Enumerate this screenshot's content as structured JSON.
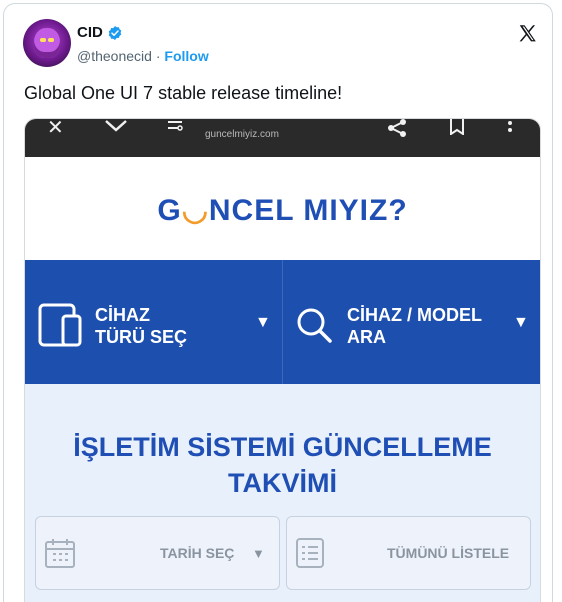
{
  "post": {
    "author": "CID",
    "handle": "@theonecid",
    "separator": "·",
    "follow_label": "Follow",
    "text": "Global One UI 7 stable release timeline!"
  },
  "screenshot": {
    "browser": {
      "url": "guncelmiyiz.com"
    },
    "site_logo": {
      "part1": "G",
      "smile": "◡",
      "part2": "NCEL MIYIZ?"
    },
    "nav": {
      "device_type": {
        "line1": "CİHAZ",
        "line2": "TÜRÜ SEÇ"
      },
      "device_search": {
        "line1": "CİHAZ / MODEL",
        "line2": "ARA"
      },
      "arrow": "▼"
    },
    "hero": {
      "title_line1": "İŞLETİM SİSTEMİ GÜNCELLEME",
      "title_line2": "TAKVİMİ",
      "date_select": "TARİH SEÇ",
      "date_arrow": "▼",
      "list_all": "TÜMÜNÜ LİSTELE"
    }
  },
  "colors": {
    "brand_blue": "#1d4fae",
    "accent_orange": "#f19c2b",
    "follow_blue": "#1d9bf0",
    "verified_blue": "#1d9bf0"
  },
  "icons": [
    "verified-badge-icon",
    "x-logo-icon",
    "close-icon",
    "chevron-down-icon",
    "page-settings-icon",
    "share-icon",
    "bookmark-icon",
    "more-icon",
    "tablet-phone-icon",
    "search-icon",
    "calendar-icon",
    "list-icon"
  ]
}
